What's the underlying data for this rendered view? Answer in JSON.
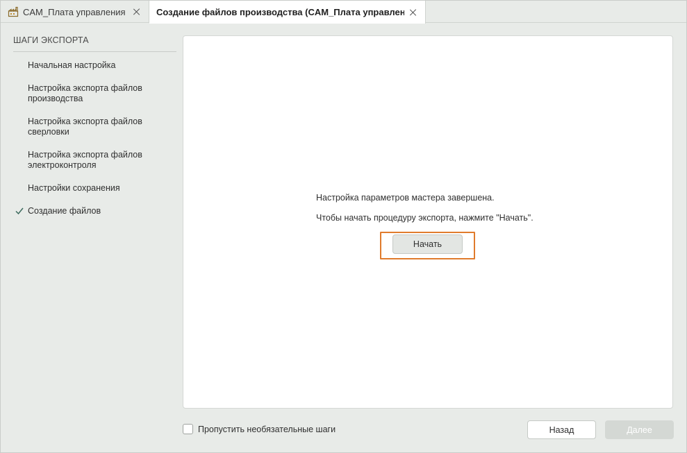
{
  "tabs": [
    {
      "label": "CAM_Плата управления",
      "icon": "factory-icon",
      "active": false
    },
    {
      "label": "Создание файлов производства (CAM_Плата управления)",
      "active": true
    }
  ],
  "sidebar": {
    "header": "ШАГИ ЭКСПОРТА",
    "steps": [
      {
        "label": "Начальная настройка",
        "done": false
      },
      {
        "label": "Настройка экспорта файлов производства",
        "done": false
      },
      {
        "label": "Настройка экспорта файлов сверловки",
        "done": false
      },
      {
        "label": "Настройка экспорта файлов электроконтроля",
        "done": false
      },
      {
        "label": "Настройки сохранения",
        "done": false
      },
      {
        "label": "Создание файлов",
        "done": true,
        "icon": "check-icon"
      }
    ]
  },
  "main": {
    "message_complete": "Настройка параметров мастера завершена.",
    "message_instruction": "Чтобы начать процедуру экспорта, нажмите \"Начать\".",
    "start_button": "Начать"
  },
  "footer": {
    "skip_label": "Пропустить необязательные шаги",
    "skip_checked": false,
    "back_button": "Назад",
    "next_button": "Далее"
  },
  "colors": {
    "highlight": "#e07b2c",
    "check": "#3d6b5e",
    "background": "#e8ebe8"
  }
}
